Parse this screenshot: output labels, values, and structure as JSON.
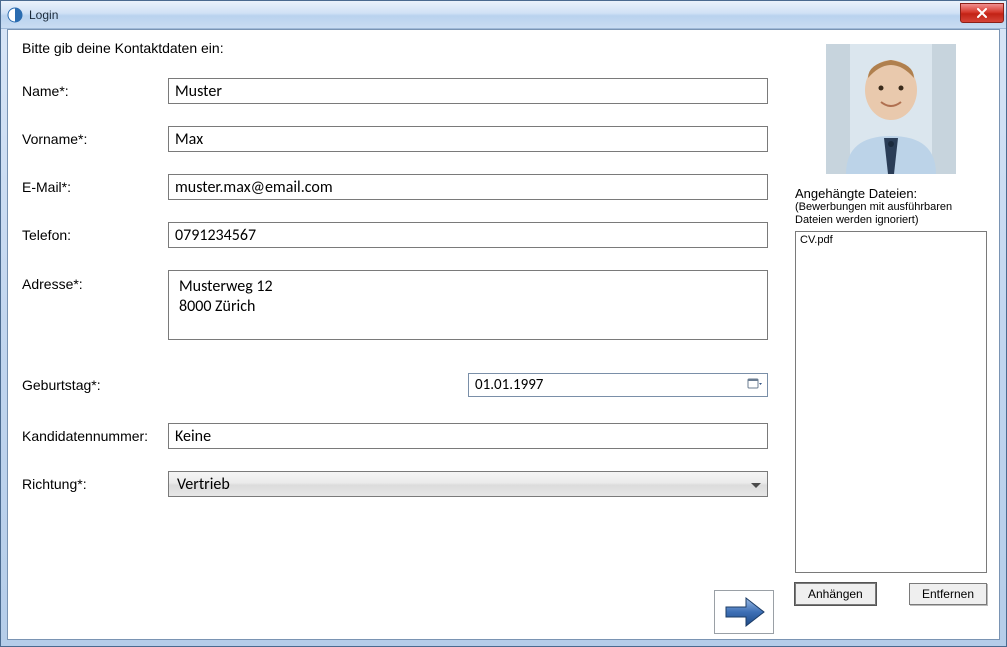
{
  "window": {
    "title": "Login"
  },
  "form": {
    "instruction": "Bitte gib deine Kontaktdaten ein:",
    "labels": {
      "name": "Name*:",
      "firstname": "Vorname*:",
      "email": "E-Mail*:",
      "phone": "Telefon:",
      "address": "Adresse*:",
      "birthday": "Geburtstag*:",
      "candidate_no": "Kandidatennummer:",
      "direction": "Richtung*:"
    },
    "values": {
      "name": "Muster",
      "firstname": "Max",
      "email": "muster.max@email.com",
      "phone": "0791234567",
      "address": "Musterweg 12\n8000 Zürich",
      "birthday": "01.01.1997",
      "candidate_no": "Keine",
      "direction": "Vertrieb"
    }
  },
  "attachments": {
    "title": "Angehängte Dateien:",
    "note": "(Bewerbungen mit ausführbaren Dateien werden ignoriert)",
    "items": [
      "CV.pdf"
    ],
    "buttons": {
      "attach": "Anhängen",
      "remove": "Entfernen"
    }
  }
}
